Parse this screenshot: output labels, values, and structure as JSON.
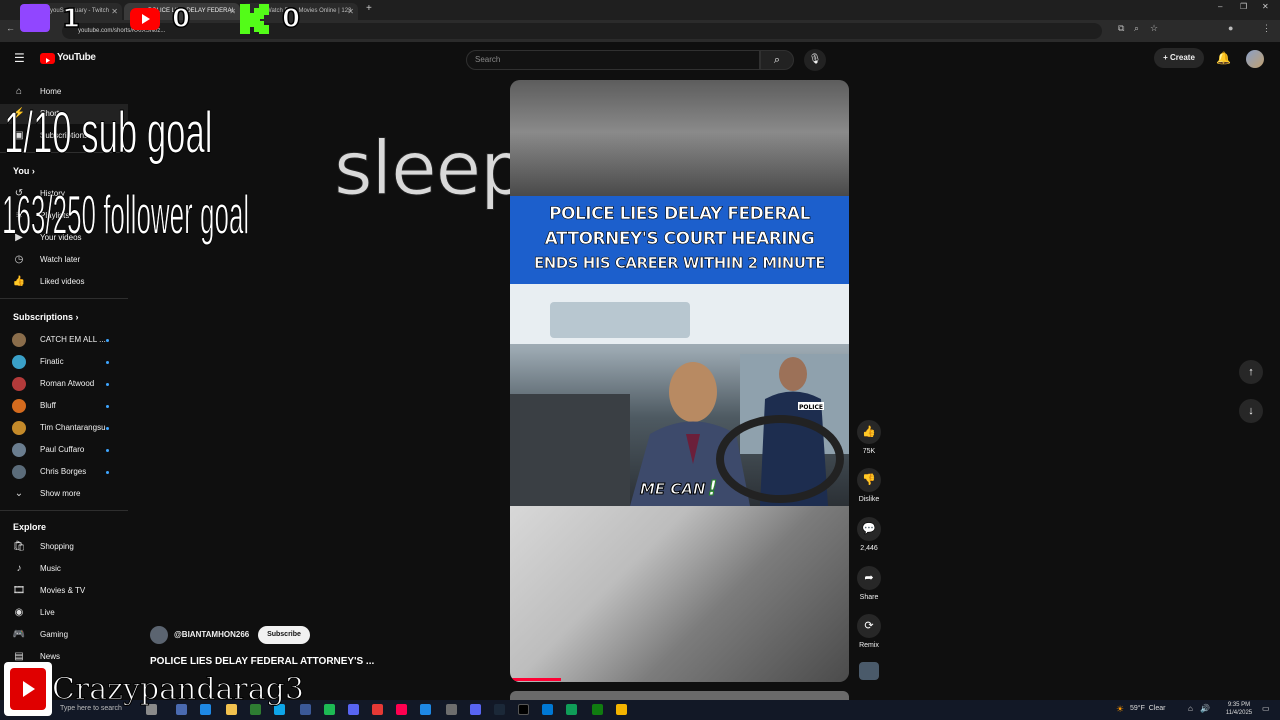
{
  "browser": {
    "tabs": [
      {
        "label": "youSanctuary - Twitch"
      },
      {
        "label": "POLICE LIES DELAY FEDERAL"
      },
      {
        "label": "Watch Free Movies Online | 123"
      }
    ],
    "new_tab": "+",
    "url": "youtube.com/shorts/KXIXSN0z...",
    "window_controls": {
      "minimize": "–",
      "restore": "❐",
      "close": "✕"
    }
  },
  "overlay": {
    "twitch_count": "1",
    "youtube_count": "0",
    "kick_count": "0",
    "sub_goal": "1/10 sub goal",
    "follower_goal": "163/250 follower goal",
    "status": "sleeping",
    "streamer_name": "Crazypandarag3"
  },
  "youtube": {
    "logo": "YouTube",
    "search_placeholder": "Search",
    "create_label": "Create",
    "sidebar": {
      "main": [
        {
          "label": "Home",
          "icon": "home-icon"
        },
        {
          "label": "Shorts",
          "icon": "shorts-icon"
        },
        {
          "label": "Subscriptions",
          "icon": "subscriptions-icon"
        }
      ],
      "you_header": "You",
      "you": [
        {
          "label": "History",
          "icon": "history-icon"
        },
        {
          "label": "Playlists",
          "icon": "playlists-icon"
        },
        {
          "label": "Your videos",
          "icon": "your-videos-icon"
        },
        {
          "label": "Watch later",
          "icon": "watch-later-icon"
        },
        {
          "label": "Liked videos",
          "icon": "liked-videos-icon"
        }
      ],
      "subscriptions_header": "Subscriptions",
      "subscriptions": [
        {
          "label": "CATCH EM ALL ...",
          "color": "#8a6d4b"
        },
        {
          "label": "Finatic",
          "color": "#3aa0c8"
        },
        {
          "label": "Roman Atwood",
          "color": "#b33a3a"
        },
        {
          "label": "Bluff",
          "color": "#d46b1e"
        },
        {
          "label": "Tim Chantarangsu",
          "color": "#c48a2a"
        },
        {
          "label": "Paul Cuffaro",
          "color": "#6a7d8f"
        },
        {
          "label": "Chris Borges",
          "color": "#5b6c7a"
        }
      ],
      "show_more": "Show more",
      "explore_header": "Explore",
      "explore": [
        {
          "label": "Shopping",
          "icon": "shopping-icon"
        },
        {
          "label": "Music",
          "icon": "music-icon"
        },
        {
          "label": "Movies & TV",
          "icon": "movies-icon"
        },
        {
          "label": "Live",
          "icon": "live-icon"
        },
        {
          "label": "Gaming",
          "icon": "gaming-icon"
        },
        {
          "label": "News",
          "icon": "news-icon"
        }
      ]
    },
    "short": {
      "banner_lines": [
        "POLICE LIES DELAY FEDERAL",
        "ATTORNEY'S COURT HEARING",
        "ENDS HIS CAREER WITHIN 2 MINUTE"
      ],
      "caption": "ME CAN",
      "caption_mark": "!",
      "police_patch": "POLICE",
      "progress_fraction": 0.15,
      "channel": "@BIANTAMHON266",
      "subscribe": "Subscribe",
      "title": "POLICE LIES DELAY FEDERAL ATTORNEY'S ..."
    },
    "actions": {
      "likes": "75K",
      "dislike": "Dislike",
      "comments": "2,446",
      "share": "Share",
      "remix": "Remix"
    }
  },
  "taskbar": {
    "search_text": "Type here to search",
    "weather": "59°F  Clear",
    "time": "9:35 PM",
    "date": "11/4/2025"
  }
}
